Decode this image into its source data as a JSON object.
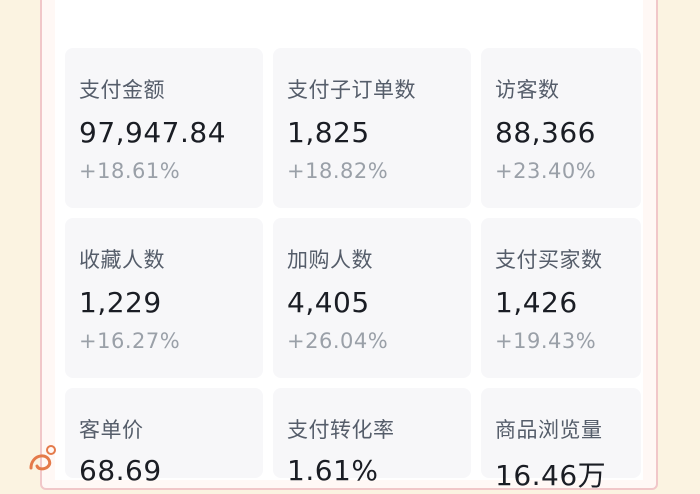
{
  "colors": {
    "background": "#fbf3e1",
    "frame_border": "#f1c7c9",
    "card_bg": "#f7f7f9",
    "label": "#555d6a",
    "value": "#1a1d24",
    "change": "#9aa0a8"
  },
  "metrics": [
    {
      "label": "支付金额",
      "value": "97,947.84",
      "change": "+18.61%"
    },
    {
      "label": "支付子订单数",
      "value": "1,825",
      "change": "+18.82%"
    },
    {
      "label": "访客数",
      "value": "88,366",
      "change": "+23.40%"
    },
    {
      "label": "收藏人数",
      "value": "1,229",
      "change": "+16.27%"
    },
    {
      "label": "加购人数",
      "value": "4,405",
      "change": "+26.04%"
    },
    {
      "label": "支付买家数",
      "value": "1,426",
      "change": "+19.43%"
    },
    {
      "label": "客单价",
      "value": "68.69",
      "change": ""
    },
    {
      "label": "支付转化率",
      "value": "1.61%",
      "change": ""
    },
    {
      "label": "商品浏览量",
      "value": "16.46万",
      "change": ""
    }
  ]
}
